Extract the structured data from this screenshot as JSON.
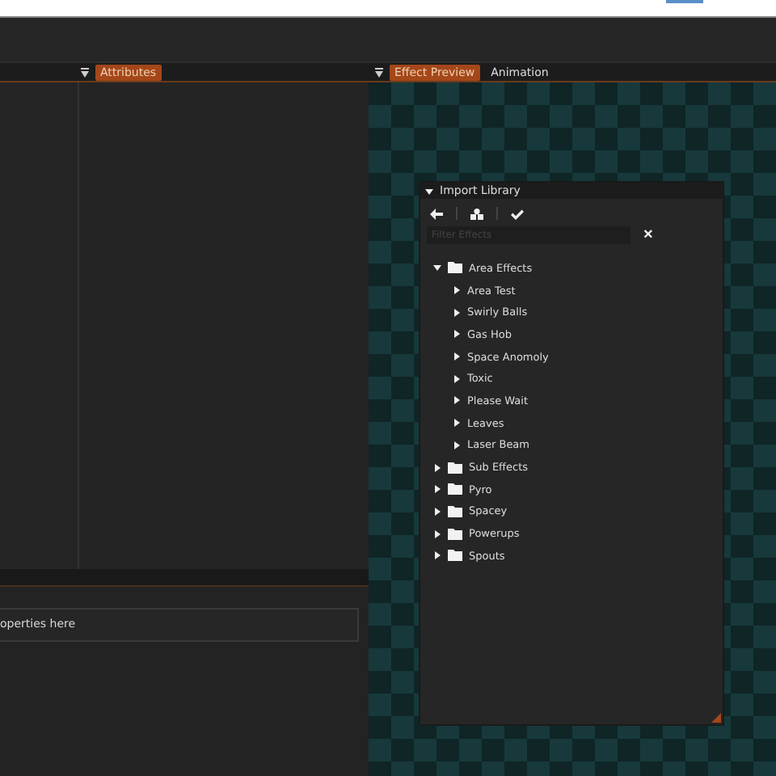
{
  "attributes_panel": {
    "tabs": [
      {
        "label": "Attributes",
        "selected": true
      }
    ]
  },
  "preview_panel": {
    "tabs": [
      {
        "label": "Effect Preview",
        "selected": true
      },
      {
        "label": "Animation",
        "selected": false
      }
    ]
  },
  "properties_field": {
    "placeholder": "operties here"
  },
  "import_library": {
    "title": "Import Library",
    "expanded": true,
    "filter": {
      "placeholder": "Filter Effects"
    },
    "clear": "×",
    "tree": [
      {
        "label": "Area Effects",
        "kind": "folder",
        "expanded": true,
        "children": [
          {
            "label": "Area Test",
            "kind": "effect",
            "expanded": false
          },
          {
            "label": "Swirly Balls",
            "kind": "effect",
            "expanded": false
          },
          {
            "label": "Gas Hob",
            "kind": "effect",
            "expanded": false
          },
          {
            "label": "Space Anomoly",
            "kind": "effect",
            "expanded": false
          },
          {
            "label": "Toxic",
            "kind": "effect",
            "expanded": false
          },
          {
            "label": "Please Wait",
            "kind": "effect",
            "expanded": false
          },
          {
            "label": "Leaves",
            "kind": "effect",
            "expanded": false
          },
          {
            "label": "Laser Beam",
            "kind": "effect",
            "expanded": false
          }
        ]
      },
      {
        "label": "Sub Effects",
        "kind": "folder",
        "expanded": false
      },
      {
        "label": "Pyro",
        "kind": "folder",
        "expanded": false
      },
      {
        "label": "Spacey",
        "kind": "folder",
        "expanded": false
      },
      {
        "label": "Powerups",
        "kind": "folder",
        "expanded": false
      },
      {
        "label": "Spouts",
        "kind": "folder",
        "expanded": false
      }
    ]
  }
}
